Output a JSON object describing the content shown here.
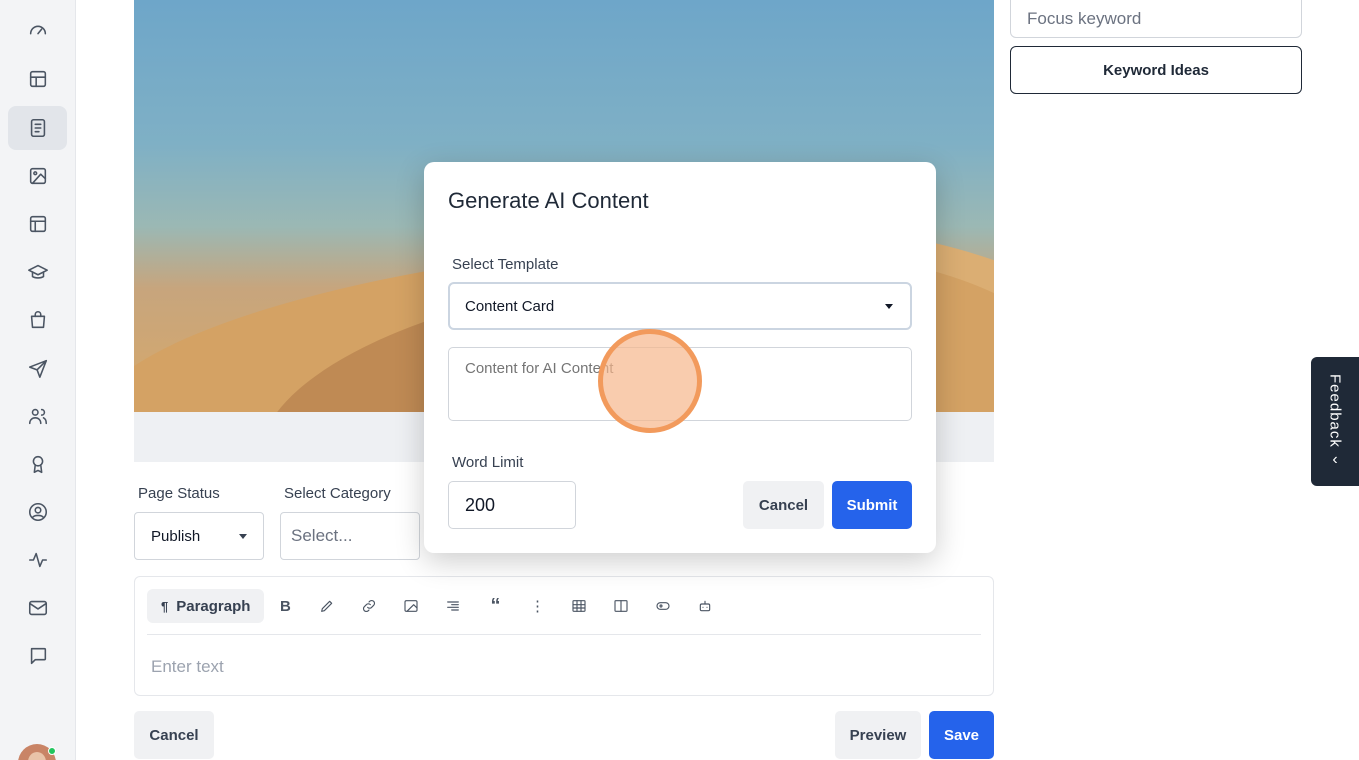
{
  "sidebar": {
    "items": [
      {
        "name": "dashboard-icon"
      },
      {
        "name": "layout-icon"
      },
      {
        "name": "pages-icon",
        "active": true
      },
      {
        "name": "media-icon"
      },
      {
        "name": "templates-icon"
      },
      {
        "name": "courses-icon"
      },
      {
        "name": "store-icon"
      },
      {
        "name": "send-icon"
      },
      {
        "name": "users-icon"
      },
      {
        "name": "badge-icon"
      },
      {
        "name": "account-icon"
      },
      {
        "name": "activity-icon"
      },
      {
        "name": "mail-icon"
      },
      {
        "name": "chat-icon"
      }
    ]
  },
  "seo": {
    "focus_placeholder": "Focus keyword",
    "keyword_button": "Keyword Ideas"
  },
  "page_form": {
    "status_label": "Page Status",
    "status_value": "Publish",
    "category_label": "Select Category",
    "category_placeholder": "Select..."
  },
  "editor": {
    "paragraph_label": "Paragraph",
    "placeholder": "Enter text"
  },
  "footer": {
    "cancel": "Cancel",
    "preview": "Preview",
    "save": "Save"
  },
  "feedback": {
    "label": "Feedback"
  },
  "modal": {
    "title": "Generate AI Content",
    "template_label": "Select Template",
    "template_value": "Content Card",
    "content_placeholder": "Content for AI Content",
    "word_limit_label": "Word Limit",
    "word_limit_value": "200",
    "cancel": "Cancel",
    "submit": "Submit"
  },
  "colors": {
    "primary": "#2563eb",
    "click_indicator": "#f29a5c"
  }
}
